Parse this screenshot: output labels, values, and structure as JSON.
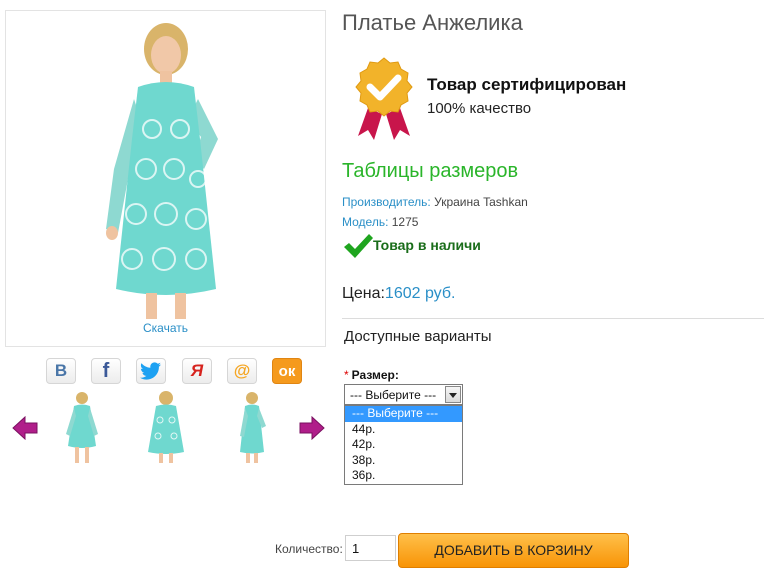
{
  "product": {
    "title": "Платье Анжелика",
    "download_label": "Скачать"
  },
  "share": {
    "items": [
      {
        "name": "vkontakte",
        "glyph": "В",
        "color": "#4a76a8"
      },
      {
        "name": "facebook",
        "glyph": "f",
        "color": "#3b5998"
      },
      {
        "name": "twitter",
        "glyph": "🐦",
        "color": "#1da1f2"
      },
      {
        "name": "moikrug",
        "glyph": "Я",
        "color": "#d6231e"
      },
      {
        "name": "mailru",
        "glyph": "@",
        "color": "#f5a623"
      },
      {
        "name": "odnoklassniki",
        "glyph": "ок",
        "color": "#f59a1d"
      }
    ]
  },
  "certificate": {
    "title": "Товар сертифицирован",
    "subtitle": "100% качество"
  },
  "size_table_link": "Таблицы размеров",
  "manufacturer": {
    "label": "Производитель:",
    "value": "Украина Tashkan"
  },
  "model": {
    "label": "Модель:",
    "value": "1275"
  },
  "stock_status": "Товар в наличи",
  "price": {
    "label": "Цена:",
    "value": "1602 руб."
  },
  "variants": {
    "title": "Доступные варианты",
    "size_label": "Размер:",
    "required_mark": "*",
    "selected": "--- Выберите ---",
    "options": [
      "--- Выберите ---",
      "44р.",
      "42р.",
      "38р.",
      "36р."
    ]
  },
  "quantity": {
    "label": "Количество:",
    "value": "1"
  },
  "cart_button": "ДОБАВИТЬ В КОРЗИНУ",
  "colors": {
    "accent_blue": "#2a8fc7",
    "green": "#2ab52a",
    "cart_orange": "#f89406",
    "dress_turquoise": "#5fd3cc"
  }
}
